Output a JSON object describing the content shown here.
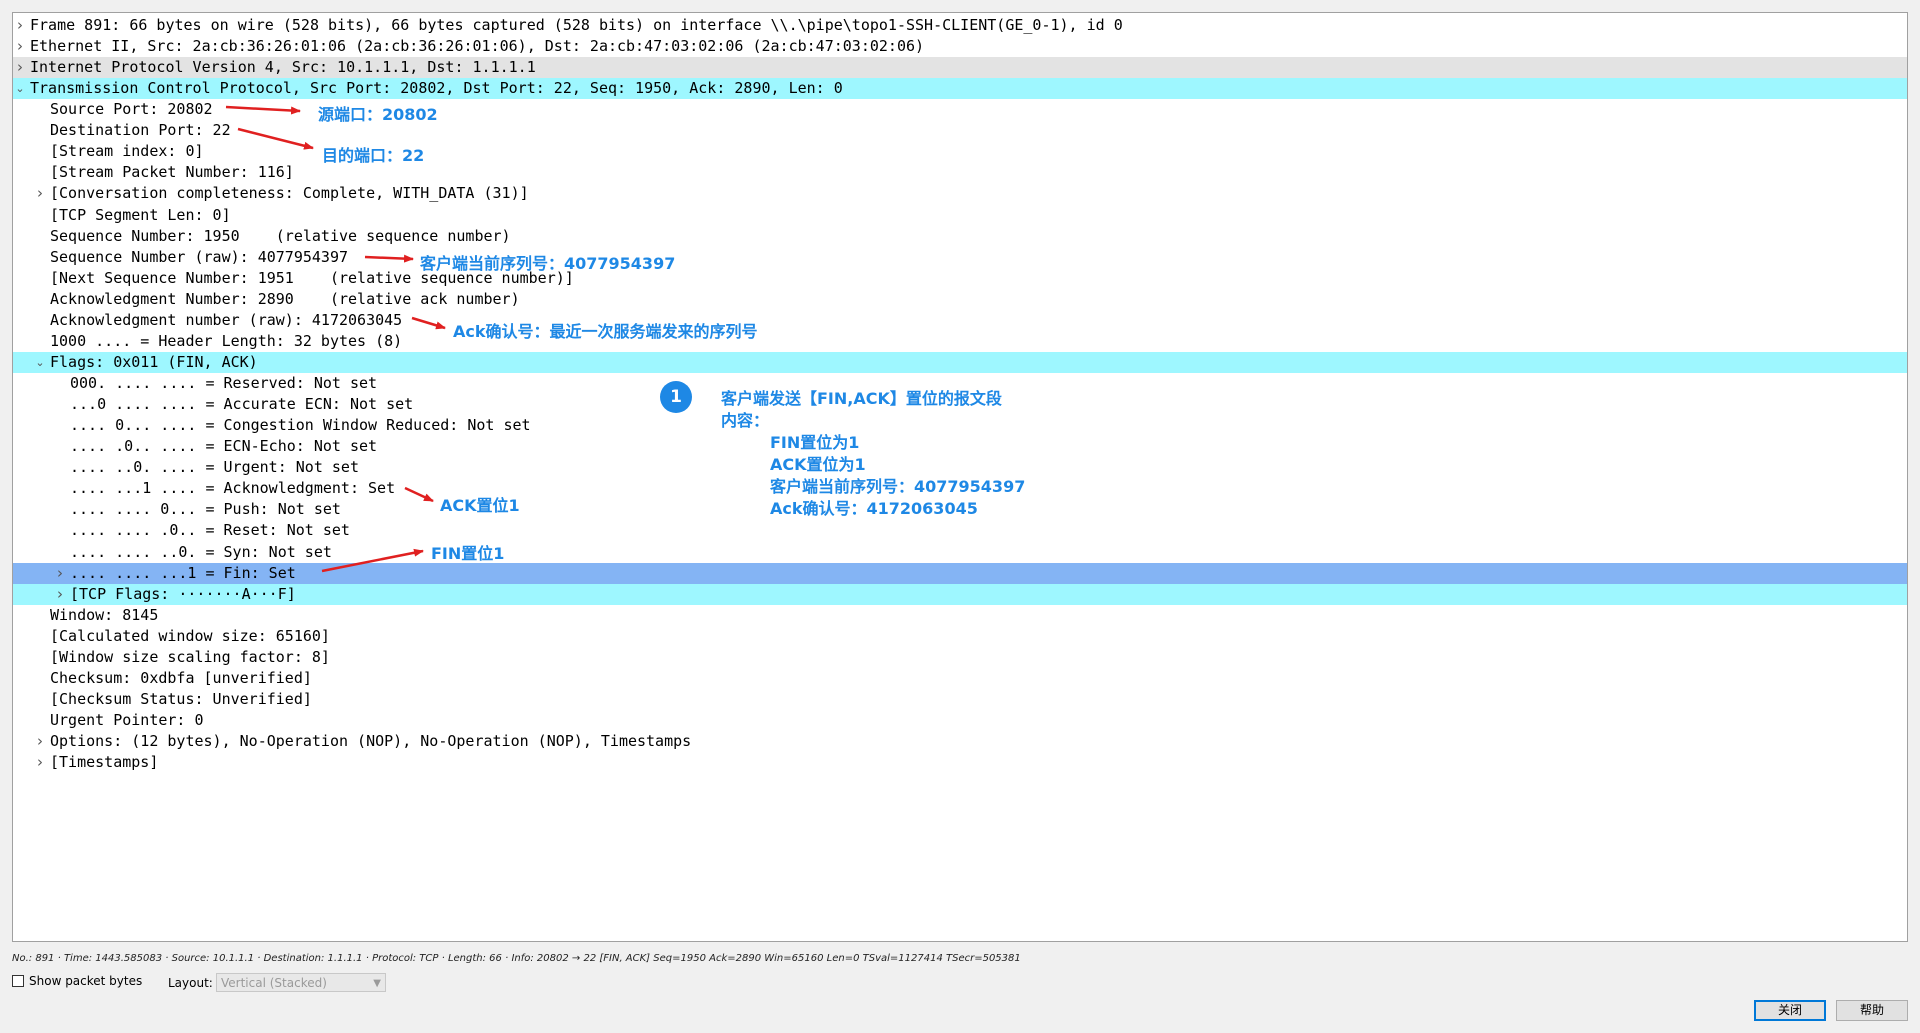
{
  "tree": [
    {
      "text": "Frame 891: 66 bytes on wire (528 bits), 66 bytes captured (528 bits) on interface \\\\.\\pipe\\topo1-SSH-CLIENT(GE_0-1), id 0",
      "indent": 0,
      "expander": "collapsed",
      "highlight": "none"
    },
    {
      "text": "Ethernet II, Src: 2a:cb:36:26:01:06 (2a:cb:36:26:01:06), Dst: 2a:cb:47:03:02:06 (2a:cb:47:03:02:06)",
      "indent": 0,
      "expander": "collapsed",
      "highlight": "none"
    },
    {
      "text": "Internet Protocol Version 4, Src: 10.1.1.1, Dst: 1.1.1.1",
      "indent": 0,
      "expander": "collapsed",
      "highlight": "gray"
    },
    {
      "text": "Transmission Control Protocol, Src Port: 20802, Dst Port: 22, Seq: 1950, Ack: 2890, Len: 0",
      "indent": 0,
      "expander": "expanded",
      "highlight": "cyan"
    },
    {
      "text": "Source Port: 20802",
      "indent": 1,
      "expander": "none",
      "highlight": "none"
    },
    {
      "text": "Destination Port: 22",
      "indent": 1,
      "expander": "none",
      "highlight": "none"
    },
    {
      "text": "[Stream index: 0]",
      "indent": 1,
      "expander": "none",
      "highlight": "none"
    },
    {
      "text": "[Stream Packet Number: 116]",
      "indent": 1,
      "expander": "none",
      "highlight": "none"
    },
    {
      "text": "[Conversation completeness: Complete, WITH_DATA (31)]",
      "indent": 1,
      "expander": "collapsed",
      "highlight": "none"
    },
    {
      "text": "[TCP Segment Len: 0]",
      "indent": 1,
      "expander": "none",
      "highlight": "none"
    },
    {
      "text": "Sequence Number: 1950    (relative sequence number)",
      "indent": 1,
      "expander": "none",
      "highlight": "none"
    },
    {
      "text": "Sequence Number (raw): 4077954397",
      "indent": 1,
      "expander": "none",
      "highlight": "none"
    },
    {
      "text": "[Next Sequence Number: 1951    (relative sequence number)]",
      "indent": 1,
      "expander": "none",
      "highlight": "none"
    },
    {
      "text": "Acknowledgment Number: 2890    (relative ack number)",
      "indent": 1,
      "expander": "none",
      "highlight": "none"
    },
    {
      "text": "Acknowledgment number (raw): 4172063045",
      "indent": 1,
      "expander": "none",
      "highlight": "none"
    },
    {
      "text": "1000 .... = Header Length: 32 bytes (8)",
      "indent": 1,
      "expander": "none",
      "highlight": "none"
    },
    {
      "text": "Flags: 0x011 (FIN, ACK)",
      "indent": 1,
      "expander": "expanded",
      "highlight": "cyan"
    },
    {
      "text": "000. .... .... = Reserved: Not set",
      "indent": 2,
      "expander": "none",
      "highlight": "none"
    },
    {
      "text": "...0 .... .... = Accurate ECN: Not set",
      "indent": 2,
      "expander": "none",
      "highlight": "none"
    },
    {
      "text": ".... 0... .... = Congestion Window Reduced: Not set",
      "indent": 2,
      "expander": "none",
      "highlight": "none"
    },
    {
      "text": ".... .0.. .... = ECN-Echo: Not set",
      "indent": 2,
      "expander": "none",
      "highlight": "none"
    },
    {
      "text": ".... ..0. .... = Urgent: Not set",
      "indent": 2,
      "expander": "none",
      "highlight": "none"
    },
    {
      "text": ".... ...1 .... = Acknowledgment: Set",
      "indent": 2,
      "expander": "none",
      "highlight": "none"
    },
    {
      "text": ".... .... 0... = Push: Not set",
      "indent": 2,
      "expander": "none",
      "highlight": "none"
    },
    {
      "text": ".... .... .0.. = Reset: Not set",
      "indent": 2,
      "expander": "none",
      "highlight": "none"
    },
    {
      "text": ".... .... ..0. = Syn: Not set",
      "indent": 2,
      "expander": "none",
      "highlight": "none"
    },
    {
      "text": ".... .... ...1 = Fin: Set",
      "indent": 2,
      "expander": "collapsed",
      "highlight": "blue"
    },
    {
      "text": "[TCP Flags: ·······A···F]",
      "indent": 2,
      "expander": "collapsed",
      "highlight": "cyan"
    },
    {
      "text": "Window: 8145",
      "indent": 1,
      "expander": "none",
      "highlight": "none"
    },
    {
      "text": "[Calculated window size: 65160]",
      "indent": 1,
      "expander": "none",
      "highlight": "none"
    },
    {
      "text": "[Window size scaling factor: 8]",
      "indent": 1,
      "expander": "none",
      "highlight": "none"
    },
    {
      "text": "Checksum: 0xdbfa [unverified]",
      "indent": 1,
      "expander": "none",
      "highlight": "none"
    },
    {
      "text": "[Checksum Status: Unverified]",
      "indent": 1,
      "expander": "none",
      "highlight": "none"
    },
    {
      "text": "Urgent Pointer: 0",
      "indent": 1,
      "expander": "none",
      "highlight": "none"
    },
    {
      "text": "Options: (12 bytes), No-Operation (NOP), No-Operation (NOP), Timestamps",
      "indent": 1,
      "expander": "collapsed",
      "highlight": "none"
    },
    {
      "text": "[Timestamps]",
      "indent": 1,
      "expander": "collapsed",
      "highlight": "none"
    }
  ],
  "annotations": {
    "src_port": "源端口：20802",
    "dst_port": "目的端口：22",
    "client_seq": "客户端当前序列号：4077954397",
    "ack_num": "Ack确认号：最近一次服务端发来的序列号",
    "ack_flag": "ACK置位1",
    "fin_flag": "FIN置位1",
    "badge": "1",
    "summary_title": "客户端发送【FIN,ACK】置位的报文段",
    "summary_content_label": "内容：",
    "summary_lines": [
      "FIN置位为1",
      "ACK置位为1",
      "客户端当前序列号：4077954397",
      "Ack确认号：4172063045"
    ]
  },
  "annotation_color": "#1e88e5",
  "arrow_color": "#e02020",
  "status_line": "No.: 891 · Time: 1443.585083 · Source: 10.1.1.1 · Destination: 1.1.1.1 · Protocol: TCP · Length: 66 · Info: 20802 → 22 [FIN, ACK] Seq=1950 Ack=2890 Win=65160 Len=0 TSval=1127414 TSecr=505381",
  "controls": {
    "show_packet_bytes": {
      "label": "Show packet bytes",
      "checked": false
    },
    "layout_label": "Layout:",
    "layout_value": "Vertical (Stacked)",
    "close_label": "关闭",
    "help_label": "帮助"
  }
}
